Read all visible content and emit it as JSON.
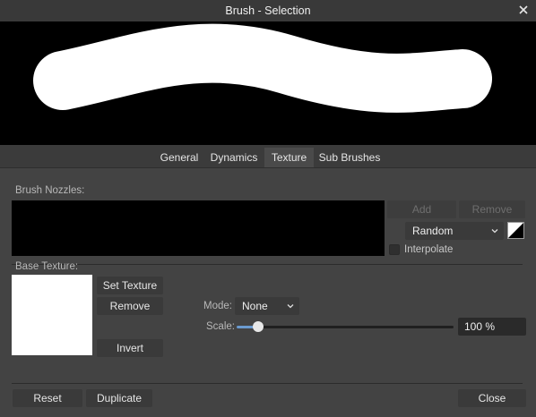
{
  "window": {
    "title": "Brush - Selection"
  },
  "tabs": [
    {
      "label": "General",
      "active": false
    },
    {
      "label": "Dynamics",
      "active": false
    },
    {
      "label": "Texture",
      "active": true
    },
    {
      "label": "Sub Brushes",
      "active": false
    }
  ],
  "nozzles": {
    "section_label": "Brush Nozzles:",
    "add_label": "Add",
    "remove_label": "Remove",
    "order_value": "Random",
    "interpolate_label": "Interpolate",
    "interpolate_checked": false
  },
  "texture": {
    "section_label": "Base Texture:",
    "set_texture_label": "Set Texture",
    "remove_label": "Remove",
    "invert_label": "Invert",
    "mode_label": "Mode:",
    "mode_value": "None",
    "scale_label": "Scale:",
    "scale_value_text": "100 %",
    "scale_fraction": 0.1
  },
  "footer": {
    "reset_label": "Reset",
    "duplicate_label": "Duplicate",
    "close_label": "Close"
  },
  "colors": {
    "accent": "#6b9bd0",
    "window_bg": "#434343",
    "preview_bg": "#000000"
  },
  "icons": {
    "close": "close-icon",
    "dropdown": "chevron-down-icon"
  }
}
